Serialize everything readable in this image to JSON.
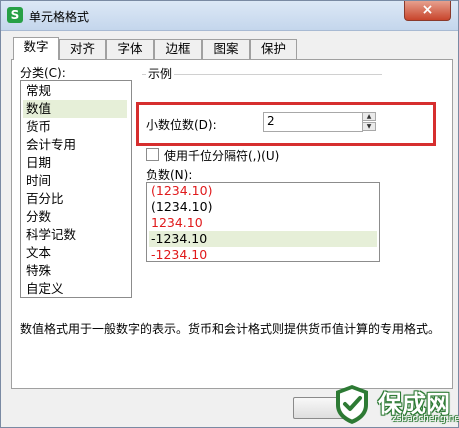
{
  "window": {
    "title": "单元格格式",
    "app_icon_letter": "S",
    "close_label": "×"
  },
  "tabs": [
    {
      "label": "数字",
      "active": true
    },
    {
      "label": "对齐",
      "active": false
    },
    {
      "label": "字体",
      "active": false
    },
    {
      "label": "边框",
      "active": false
    },
    {
      "label": "图案",
      "active": false
    },
    {
      "label": "保护",
      "active": false
    }
  ],
  "category": {
    "label": "分类(C):",
    "items": [
      "常规",
      "数值",
      "货币",
      "会计专用",
      "日期",
      "时间",
      "百分比",
      "分数",
      "科学记数",
      "文本",
      "特殊",
      "自定义"
    ],
    "selected": "数值"
  },
  "sample": {
    "label": "示例"
  },
  "decimal_places": {
    "label": "小数位数(D):",
    "value": "2"
  },
  "thousands_separator": {
    "label": "使用千位分隔符(,)(U)",
    "checked": false
  },
  "negative_numbers": {
    "label": "负数(N):",
    "items": [
      {
        "text": "(1234.10)",
        "color": "#e0191b"
      },
      {
        "text": "(1234.10)",
        "color": "#000000"
      },
      {
        "text": "1234.10",
        "color": "#e0191b"
      },
      {
        "text": "-1234.10",
        "color": "#000000"
      },
      {
        "text": "-1234.10",
        "color": "#e0191b"
      }
    ],
    "selected_index": 3
  },
  "description": "数值格式用于一般数字的表示。货币和会计格式则提供货币值计算的专用格式。",
  "watermark": {
    "text": "保成网",
    "url": "zsbaocheng.net"
  },
  "colors": {
    "highlight": "#d62e2e",
    "selection": "#e6efd8",
    "negative_red": "#e0191b",
    "watermark_green": "#2d7a34"
  }
}
